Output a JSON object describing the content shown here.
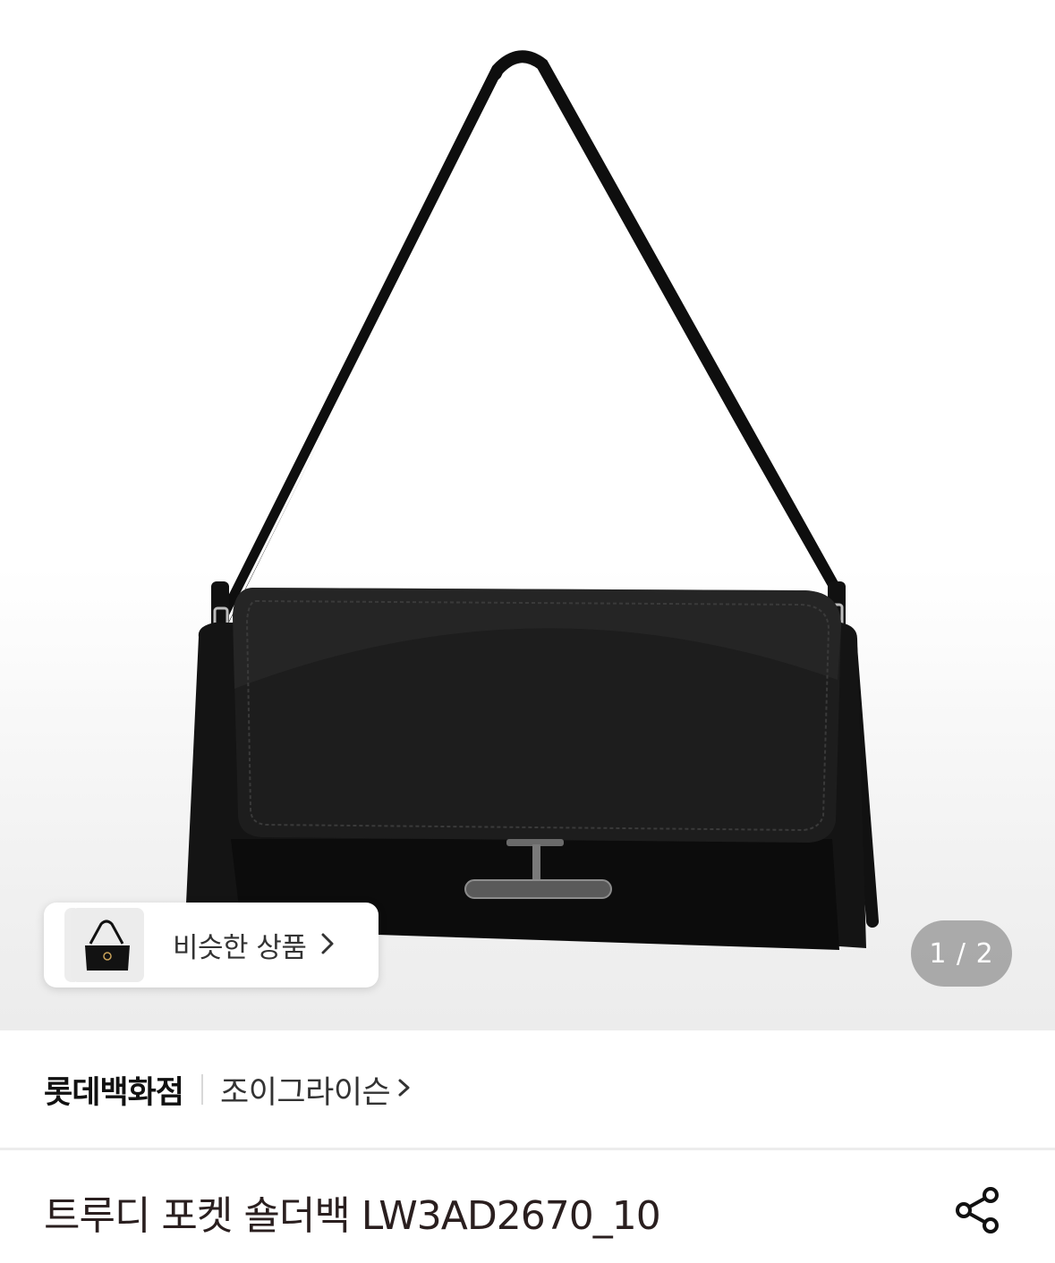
{
  "gallery": {
    "similar_products_label": "비슷한 상품",
    "page_counter": "1 / 2"
  },
  "store": {
    "name": "롯데백화점",
    "brand": "조이그라이슨"
  },
  "product": {
    "title": "트루디 포켓 숄더백 LW3AD2670_10"
  },
  "icons": {
    "similar_chevron": "chevron-right-icon",
    "brand_chevron": "chevron-right-icon",
    "share": "share-icon"
  }
}
